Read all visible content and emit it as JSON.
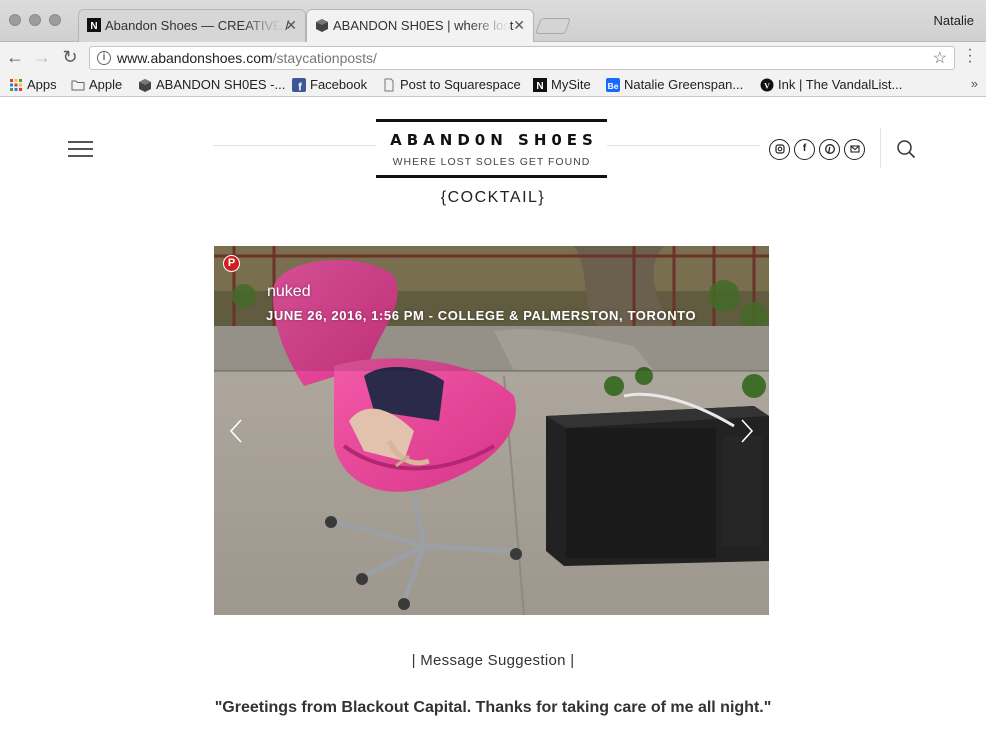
{
  "window": {
    "profile_name": "Natalie"
  },
  "tabs": [
    {
      "title": "Abandon Shoes — CREATIVE /",
      "favicon": "notion-n-icon",
      "active": false
    },
    {
      "title": "ABANDON SH0ES | where lost",
      "favicon": "cube-icon",
      "active": true
    }
  ],
  "toolbar": {
    "url_host": "www.abandonshoes.com",
    "url_path": "/staycationposts/"
  },
  "bookmarks": [
    {
      "label": "Apps",
      "icon": "apps-grid-icon"
    },
    {
      "label": "Apple",
      "icon": "folder-icon"
    },
    {
      "label": "ABANDON SH0ES -...",
      "icon": "cube-icon"
    },
    {
      "label": "Facebook",
      "icon": "facebook-icon"
    },
    {
      "label": "Post to Squarespace",
      "icon": "page-icon"
    },
    {
      "label": "MySite",
      "icon": "notion-n-icon"
    },
    {
      "label": "Natalie Greenspan...",
      "icon": "behance-icon"
    },
    {
      "label": "Ink | The VandalList...",
      "icon": "vandal-icon"
    }
  ],
  "site": {
    "logo_name": "ABAND0N SH0ES",
    "logo_tagline": "WHERE LOST SOLES GET FOUND",
    "category": "{COCKTAIL}",
    "social": [
      "instagram-icon",
      "facebook-icon",
      "pinterest-icon",
      "email-icon"
    ]
  },
  "slide": {
    "title": "nuked",
    "subtitle": "JUNE 26, 2016, 1:56 PM - COLLEGE & PALMERSTON, TORONTO"
  },
  "content": {
    "suggestion_heading": "| Message Suggestion |",
    "quote": "\"Greetings from Blackout Capital. Thanks for taking care of me all night.\""
  },
  "colors": {
    "chair_pink": "#e8459a",
    "microwave": "#1e1e1e",
    "pinterest_red": "#d01e1e"
  }
}
